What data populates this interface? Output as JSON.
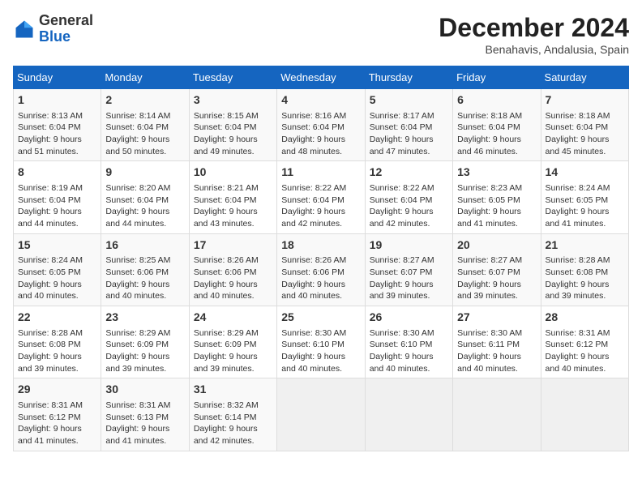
{
  "header": {
    "logo_general": "General",
    "logo_blue": "Blue",
    "month_title": "December 2024",
    "subtitle": "Benahavis, Andalusia, Spain"
  },
  "weekdays": [
    "Sunday",
    "Monday",
    "Tuesday",
    "Wednesday",
    "Thursday",
    "Friday",
    "Saturday"
  ],
  "weeks": [
    [
      {
        "day": "1",
        "info": "Sunrise: 8:13 AM\nSunset: 6:04 PM\nDaylight: 9 hours and 51 minutes."
      },
      {
        "day": "2",
        "info": "Sunrise: 8:14 AM\nSunset: 6:04 PM\nDaylight: 9 hours and 50 minutes."
      },
      {
        "day": "3",
        "info": "Sunrise: 8:15 AM\nSunset: 6:04 PM\nDaylight: 9 hours and 49 minutes."
      },
      {
        "day": "4",
        "info": "Sunrise: 8:16 AM\nSunset: 6:04 PM\nDaylight: 9 hours and 48 minutes."
      },
      {
        "day": "5",
        "info": "Sunrise: 8:17 AM\nSunset: 6:04 PM\nDaylight: 9 hours and 47 minutes."
      },
      {
        "day": "6",
        "info": "Sunrise: 8:18 AM\nSunset: 6:04 PM\nDaylight: 9 hours and 46 minutes."
      },
      {
        "day": "7",
        "info": "Sunrise: 8:18 AM\nSunset: 6:04 PM\nDaylight: 9 hours and 45 minutes."
      }
    ],
    [
      {
        "day": "8",
        "info": "Sunrise: 8:19 AM\nSunset: 6:04 PM\nDaylight: 9 hours and 44 minutes."
      },
      {
        "day": "9",
        "info": "Sunrise: 8:20 AM\nSunset: 6:04 PM\nDaylight: 9 hours and 44 minutes."
      },
      {
        "day": "10",
        "info": "Sunrise: 8:21 AM\nSunset: 6:04 PM\nDaylight: 9 hours and 43 minutes."
      },
      {
        "day": "11",
        "info": "Sunrise: 8:22 AM\nSunset: 6:04 PM\nDaylight: 9 hours and 42 minutes."
      },
      {
        "day": "12",
        "info": "Sunrise: 8:22 AM\nSunset: 6:04 PM\nDaylight: 9 hours and 42 minutes."
      },
      {
        "day": "13",
        "info": "Sunrise: 8:23 AM\nSunset: 6:05 PM\nDaylight: 9 hours and 41 minutes."
      },
      {
        "day": "14",
        "info": "Sunrise: 8:24 AM\nSunset: 6:05 PM\nDaylight: 9 hours and 41 minutes."
      }
    ],
    [
      {
        "day": "15",
        "info": "Sunrise: 8:24 AM\nSunset: 6:05 PM\nDaylight: 9 hours and 40 minutes."
      },
      {
        "day": "16",
        "info": "Sunrise: 8:25 AM\nSunset: 6:06 PM\nDaylight: 9 hours and 40 minutes."
      },
      {
        "day": "17",
        "info": "Sunrise: 8:26 AM\nSunset: 6:06 PM\nDaylight: 9 hours and 40 minutes."
      },
      {
        "day": "18",
        "info": "Sunrise: 8:26 AM\nSunset: 6:06 PM\nDaylight: 9 hours and 40 minutes."
      },
      {
        "day": "19",
        "info": "Sunrise: 8:27 AM\nSunset: 6:07 PM\nDaylight: 9 hours and 39 minutes."
      },
      {
        "day": "20",
        "info": "Sunrise: 8:27 AM\nSunset: 6:07 PM\nDaylight: 9 hours and 39 minutes."
      },
      {
        "day": "21",
        "info": "Sunrise: 8:28 AM\nSunset: 6:08 PM\nDaylight: 9 hours and 39 minutes."
      }
    ],
    [
      {
        "day": "22",
        "info": "Sunrise: 8:28 AM\nSunset: 6:08 PM\nDaylight: 9 hours and 39 minutes."
      },
      {
        "day": "23",
        "info": "Sunrise: 8:29 AM\nSunset: 6:09 PM\nDaylight: 9 hours and 39 minutes."
      },
      {
        "day": "24",
        "info": "Sunrise: 8:29 AM\nSunset: 6:09 PM\nDaylight: 9 hours and 39 minutes."
      },
      {
        "day": "25",
        "info": "Sunrise: 8:30 AM\nSunset: 6:10 PM\nDaylight: 9 hours and 40 minutes."
      },
      {
        "day": "26",
        "info": "Sunrise: 8:30 AM\nSunset: 6:10 PM\nDaylight: 9 hours and 40 minutes."
      },
      {
        "day": "27",
        "info": "Sunrise: 8:30 AM\nSunset: 6:11 PM\nDaylight: 9 hours and 40 minutes."
      },
      {
        "day": "28",
        "info": "Sunrise: 8:31 AM\nSunset: 6:12 PM\nDaylight: 9 hours and 40 minutes."
      }
    ],
    [
      {
        "day": "29",
        "info": "Sunrise: 8:31 AM\nSunset: 6:12 PM\nDaylight: 9 hours and 41 minutes."
      },
      {
        "day": "30",
        "info": "Sunrise: 8:31 AM\nSunset: 6:13 PM\nDaylight: 9 hours and 41 minutes."
      },
      {
        "day": "31",
        "info": "Sunrise: 8:32 AM\nSunset: 6:14 PM\nDaylight: 9 hours and 42 minutes."
      },
      null,
      null,
      null,
      null
    ]
  ]
}
